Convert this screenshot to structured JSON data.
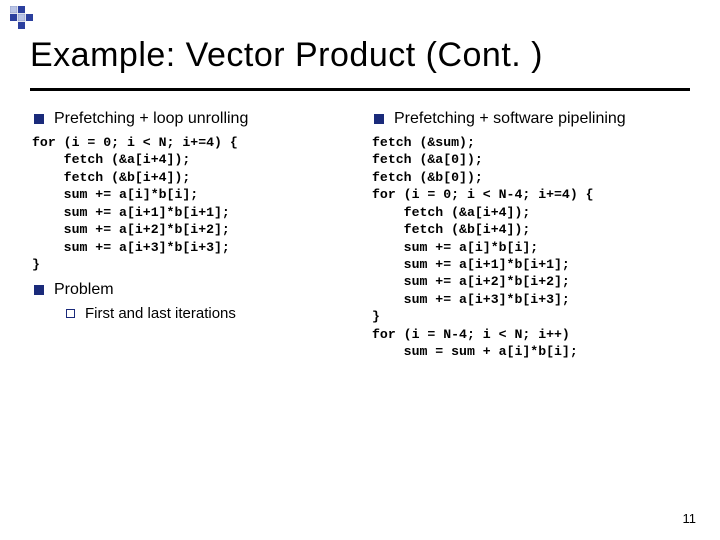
{
  "title": "Example: Vector Product (Cont. )",
  "left": {
    "heading": "Prefetching + loop unrolling",
    "code": "for (i = 0; i < N; i+=4) {\n    fetch (&a[i+4]);\n    fetch (&b[i+4]);\n    sum += a[i]*b[i];\n    sum += a[i+1]*b[i+1];\n    sum += a[i+2]*b[i+2];\n    sum += a[i+3]*b[i+3];\n}",
    "problem_label": "Problem",
    "problem_sub": "First and last iterations"
  },
  "right": {
    "heading": "Prefetching + software pipelining",
    "code": "fetch (&sum);\nfetch (&a[0]);\nfetch (&b[0]);\nfor (i = 0; i < N-4; i+=4) {\n    fetch (&a[i+4]);\n    fetch (&b[i+4]);\n    sum += a[i]*b[i];\n    sum += a[i+1]*b[i+1];\n    sum += a[i+2]*b[i+2];\n    sum += a[i+3]*b[i+3];\n}\nfor (i = N-4; i < N; i++)\n    sum = sum + a[i]*b[i];"
  },
  "page_number": "11"
}
